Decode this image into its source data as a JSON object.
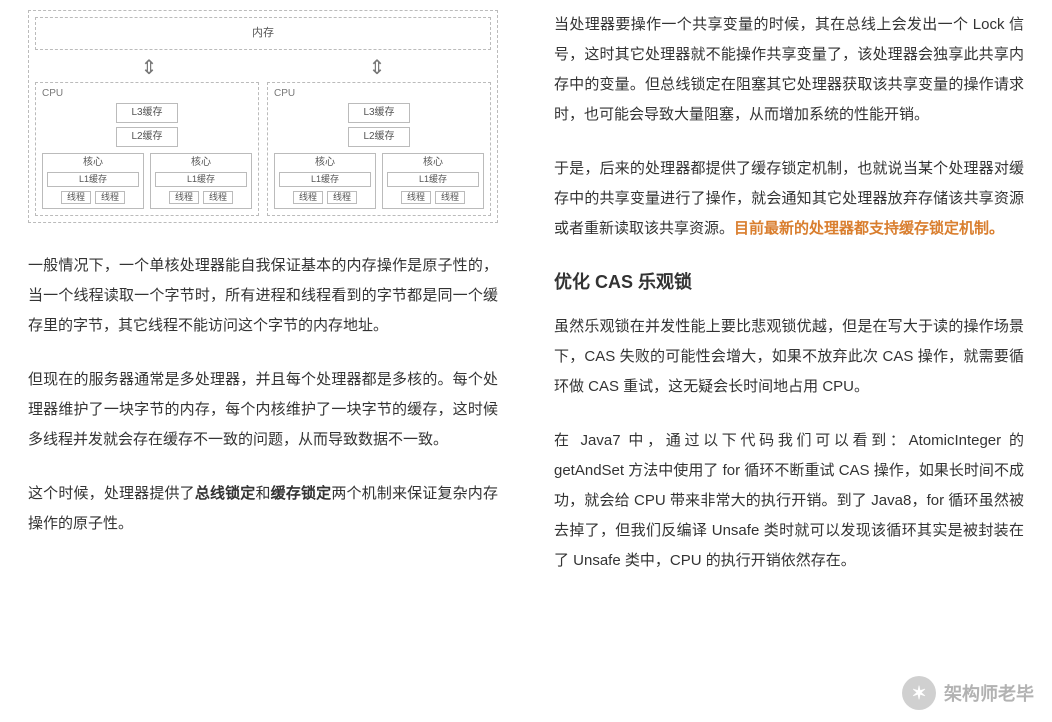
{
  "diagram": {
    "memory": "内存",
    "cpu_label": "CPU",
    "l3": "L3缓存",
    "l2": "L2缓存",
    "core": "核心",
    "l1": "L1缓存",
    "thread_a": "线程",
    "thread_b": "线程"
  },
  "left": {
    "p1": "一般情况下，一个单核处理器能自我保证基本的内存操作是原子性的，当一个线程读取一个字节时，所有进程和线程看到的字节都是同一个缓存里的字节，其它线程不能访问这个字节的内存地址。",
    "p2": "但现在的服务器通常是多处理器，并且每个处理器都是多核的。每个处理器维护了一块字节的内存，每个内核维护了一块字节的缓存，这时候多线程并发就会存在缓存不一致的问题，从而导致数据不一致。",
    "p3_a": "这个时候，处理器提供了",
    "p3_b": "总线锁定",
    "p3_c": "和",
    "p3_d": "缓存锁定",
    "p3_e": "两个机制来保证复杂内存操作的原子性。"
  },
  "right": {
    "p1": "当处理器要操作一个共享变量的时候，其在总线上会发出一个 Lock 信号，这时其它处理器就不能操作共享变量了，该处理器会独享此共享内存中的变量。但总线锁定在阻塞其它处理器获取该共享变量的操作请求时，也可能会导致大量阻塞，从而增加系统的性能开销。",
    "p2_a": "于是，后来的处理器都提供了缓存锁定机制，也就说当某个处理器对缓存中的共享变量进行了操作，就会通知其它处理器放弃存储该共享资源或者重新读取该共享资源。",
    "p2_b": "目前最新的处理器都支持缓存锁定机制。",
    "h3": "优化 CAS 乐观锁",
    "p3": "虽然乐观锁在并发性能上要比悲观锁优越，但是在写大于读的操作场景下，CAS 失败的可能性会增大，如果不放弃此次 CAS 操作，就需要循环做 CAS 重试，这无疑会长时间地占用 CPU。",
    "p4": "在 Java7 中，通过以下代码我们可以看到：AtomicInteger 的 getAndSet 方法中使用了 for 循环不断重试 CAS 操作，如果长时间不成功，就会给 CPU 带来非常大的执行开销。到了 Java8，for 循环虽然被去掉了，但我们反编译 Unsafe 类时就可以发现该循环其实是被封装在了 Unsafe 类中，CPU 的执行开销依然存在。"
  },
  "watermark": {
    "text": "架构师老毕",
    "icon": "✶"
  }
}
